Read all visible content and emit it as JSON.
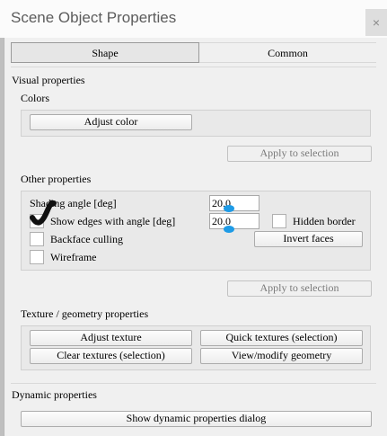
{
  "window": {
    "title": "Scene Object Properties",
    "close_glyph": "×"
  },
  "tabs": [
    {
      "label": "Shape",
      "active": true
    },
    {
      "label": "Common",
      "active": false
    }
  ],
  "visual": {
    "heading": "Visual properties",
    "colors": {
      "heading": "Colors",
      "adjust_color": "Adjust color",
      "apply": "Apply to selection"
    },
    "other": {
      "heading": "Other properties",
      "shading_angle_label": "Shading angle [deg]",
      "shading_angle_value": "20.0",
      "show_edges_label": "Show edges with angle [deg]",
      "show_edges_value": "20.0",
      "hidden_border_label": "Hidden border",
      "invert_faces": "Invert faces",
      "backface_culling_label": "Backface culling",
      "wireframe_label": "Wireframe",
      "apply": "Apply to selection"
    },
    "texture": {
      "heading": "Texture / geometry properties",
      "adjust_texture": "Adjust texture",
      "quick_textures": "Quick textures (selection)",
      "clear_textures": "Clear textures (selection)",
      "view_geometry": "View/modify geometry"
    }
  },
  "dynamic": {
    "heading": "Dynamic properties",
    "show_dialog": "Show dynamic properties dialog"
  },
  "colors": {
    "annotation_mark": "#111111",
    "cursor_marker": "#1e9be6"
  }
}
